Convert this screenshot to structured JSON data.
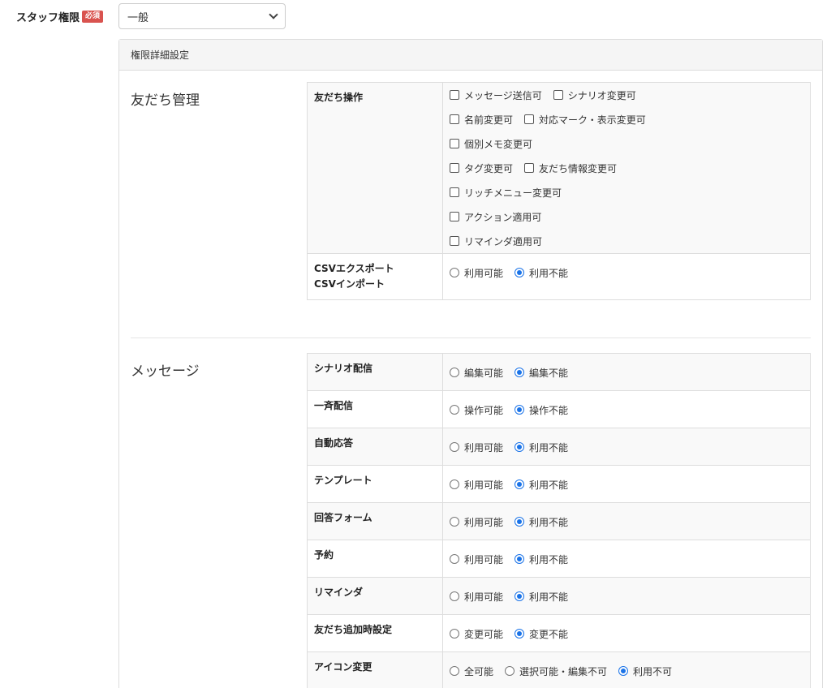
{
  "staff": {
    "label": "スタッフ権限",
    "required_badge": "必須",
    "select_value": "一般"
  },
  "panel": {
    "title": "権限詳細設定"
  },
  "friends_section": {
    "title": "友だち管理",
    "operations": {
      "label": "友だち操作",
      "lines": [
        [
          {
            "label": "メッセージ送信可",
            "checked": false
          },
          {
            "label": "シナリオ変更可",
            "checked": false
          }
        ],
        [
          {
            "label": "名前変更可",
            "checked": false
          },
          {
            "label": "対応マーク・表示変更可",
            "checked": false
          }
        ],
        [
          {
            "label": "個別メモ変更可",
            "checked": false
          }
        ],
        [
          {
            "label": "タグ変更可",
            "checked": false
          },
          {
            "label": "友だち情報変更可",
            "checked": false
          }
        ],
        [
          {
            "label": "リッチメニュー変更可",
            "checked": false
          }
        ],
        [
          {
            "label": "アクション適用可",
            "checked": false
          }
        ],
        [
          {
            "label": "リマインダ適用可",
            "checked": false
          }
        ]
      ]
    },
    "csv": {
      "label_line1": "CSVエクスポート",
      "label_line2": "CSVインポート",
      "options": [
        {
          "label": "利用可能",
          "selected": false
        },
        {
          "label": "利用不能",
          "selected": true
        }
      ]
    }
  },
  "message_section": {
    "title": "メッセージ",
    "rows": [
      {
        "label": "シナリオ配信",
        "options": [
          {
            "label": "編集可能",
            "selected": false
          },
          {
            "label": "編集不能",
            "selected": true
          }
        ]
      },
      {
        "label": "一斉配信",
        "options": [
          {
            "label": "操作可能",
            "selected": false
          },
          {
            "label": "操作不能",
            "selected": true
          }
        ]
      },
      {
        "label": "自動応答",
        "options": [
          {
            "label": "利用可能",
            "selected": false
          },
          {
            "label": "利用不能",
            "selected": true
          }
        ]
      },
      {
        "label": "テンプレート",
        "options": [
          {
            "label": "利用可能",
            "selected": false
          },
          {
            "label": "利用不能",
            "selected": true
          }
        ]
      },
      {
        "label": "回答フォーム",
        "options": [
          {
            "label": "利用可能",
            "selected": false
          },
          {
            "label": "利用不能",
            "selected": true
          }
        ]
      },
      {
        "label": "予約",
        "options": [
          {
            "label": "利用可能",
            "selected": false
          },
          {
            "label": "利用不能",
            "selected": true
          }
        ]
      },
      {
        "label": "リマインダ",
        "options": [
          {
            "label": "利用可能",
            "selected": false
          },
          {
            "label": "利用不能",
            "selected": true
          }
        ]
      },
      {
        "label": "友だち追加時設定",
        "options": [
          {
            "label": "変更可能",
            "selected": false
          },
          {
            "label": "変更不能",
            "selected": true
          }
        ]
      },
      {
        "label": "アイコン変更",
        "options": [
          {
            "label": "全可能",
            "selected": false
          },
          {
            "label": "選択可能・編集不可",
            "selected": false
          },
          {
            "label": "利用不可",
            "selected": true
          }
        ]
      }
    ]
  },
  "colors": {
    "accent": "#1a73e8",
    "required_badge": "#d9534f",
    "panel_header_bg": "#f5f5f5",
    "row_alt_bg": "#f9f9f9"
  }
}
